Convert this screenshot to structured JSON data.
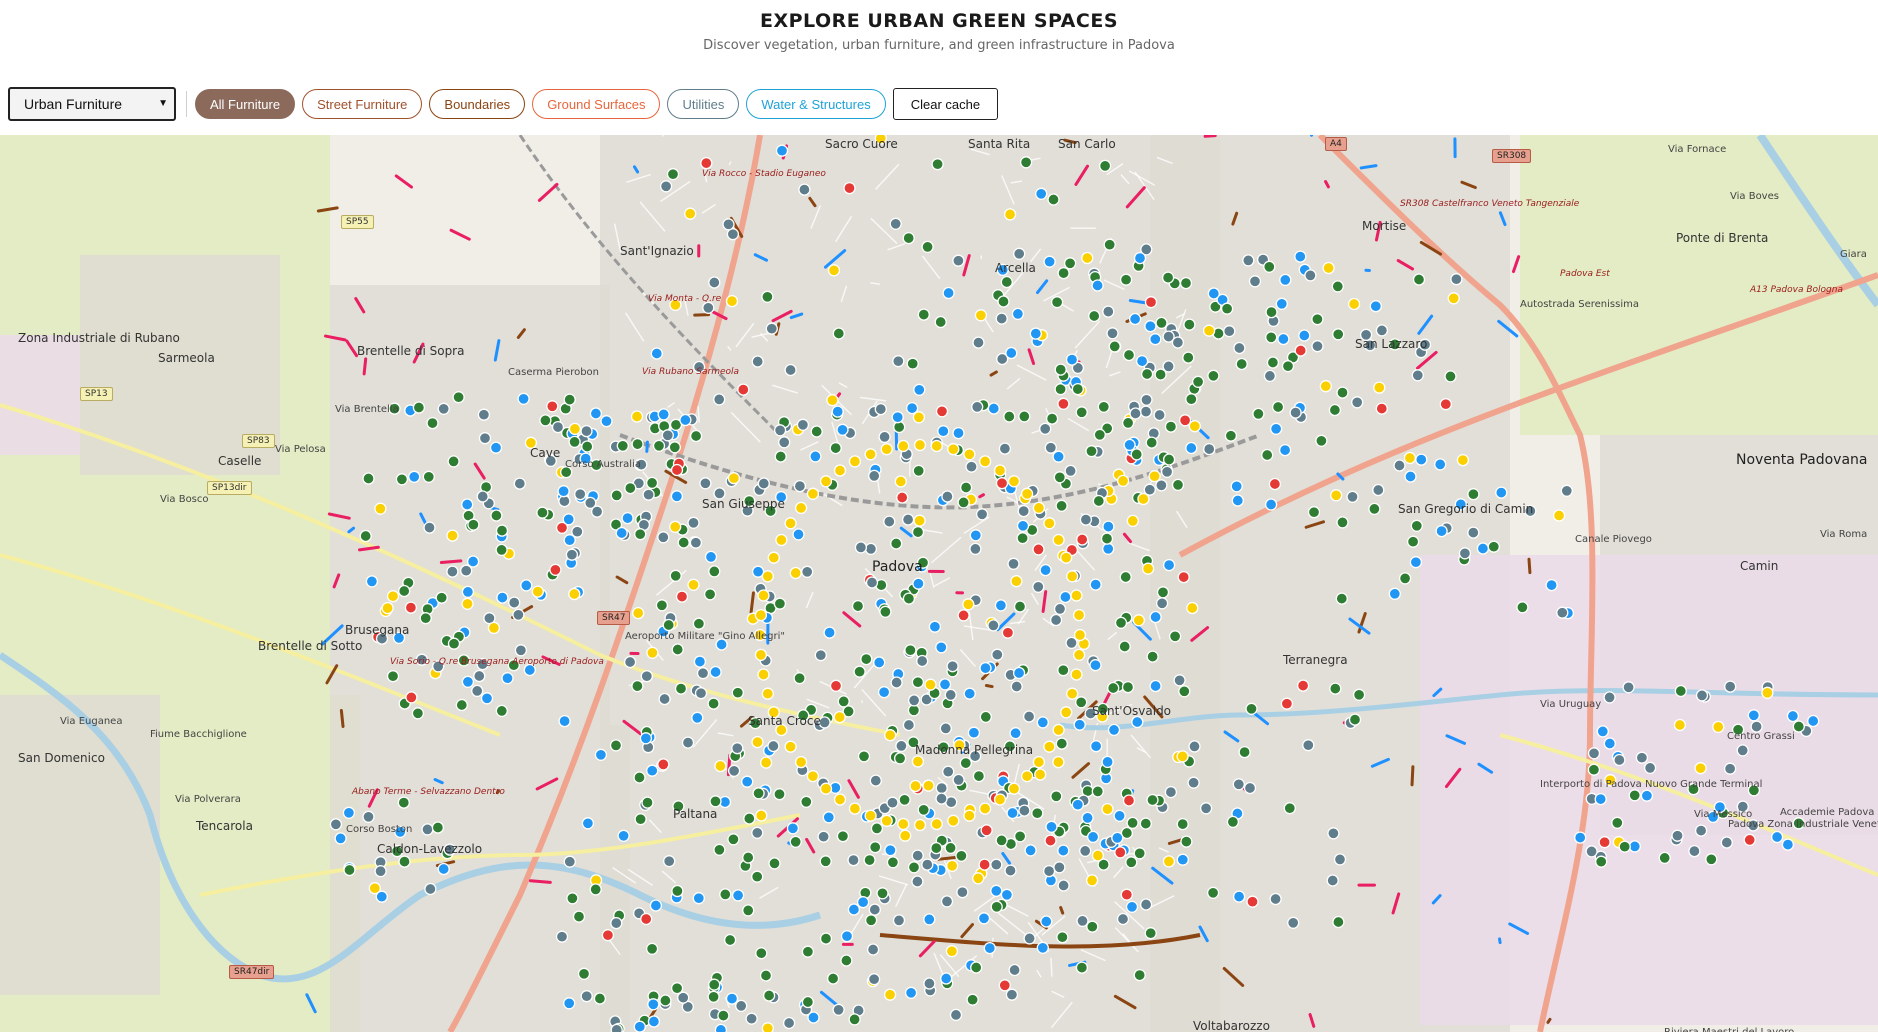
{
  "header": {
    "title": "EXPLORE URBAN GREEN SPACES",
    "subtitle": "Discover vegetation, urban furniture, and green infrastructure in Padova"
  },
  "toolbar": {
    "category_select": {
      "selected": "Urban Furniture"
    },
    "filters": [
      {
        "label": "All Furniture",
        "color": "#8b6a5c",
        "active": true
      },
      {
        "label": "Street Furniture",
        "color": "#a0522d",
        "active": false
      },
      {
        "label": "Boundaries",
        "color": "#8b4513",
        "active": false
      },
      {
        "label": "Ground Surfaces",
        "color": "#e8663d",
        "active": false
      },
      {
        "label": "Utilities",
        "color": "#607d8b",
        "active": false
      },
      {
        "label": "Water & Structures",
        "color": "#1fa3d6",
        "active": false
      }
    ],
    "clear_label": "Clear cache"
  },
  "map": {
    "colors": {
      "background": "#f1eee8",
      "farmland": "#e3ecc4",
      "residential": "#dedcd4",
      "industrial": "#ebdbe8",
      "water": "#a9cfe4",
      "major_road": "#f0a48e",
      "secondary_road": "#f6ef9f",
      "rail": "#9a9a9a",
      "marker_green": "#2e7d32",
      "marker_blue": "#2196f3",
      "marker_gray": "#607d8b",
      "marker_yellow": "#fbd000",
      "marker_red": "#e53935",
      "line_brown": "#8b4513",
      "line_magenta": "#e91e63",
      "line_blue": "#1e90ff"
    },
    "places": [
      {
        "name": "Padova",
        "kind": "city"
      },
      {
        "name": "Noventa Padovana",
        "kind": "city"
      },
      {
        "name": "Sarmeola",
        "kind": "town"
      },
      {
        "name": "Zona Industriale di Rubano",
        "kind": "town"
      },
      {
        "name": "Caselle",
        "kind": "town"
      },
      {
        "name": "Brentelle di Sopra",
        "kind": "town"
      },
      {
        "name": "Sant'Ignazio",
        "kind": "town"
      },
      {
        "name": "Arcella",
        "kind": "town"
      },
      {
        "name": "Sacro Cuore",
        "kind": "town"
      },
      {
        "name": "Santa Rita",
        "kind": "town"
      },
      {
        "name": "San Carlo",
        "kind": "town"
      },
      {
        "name": "Mortise",
        "kind": "town"
      },
      {
        "name": "Ponte di Brenta",
        "kind": "town"
      },
      {
        "name": "San Lazzaro",
        "kind": "town"
      },
      {
        "name": "Cave",
        "kind": "town"
      },
      {
        "name": "San Giuseppe",
        "kind": "town"
      },
      {
        "name": "San Gregorio di Camin",
        "kind": "town"
      },
      {
        "name": "Camin",
        "kind": "town"
      },
      {
        "name": "Brusegana",
        "kind": "town"
      },
      {
        "name": "Brentelle di Sotto",
        "kind": "town"
      },
      {
        "name": "Tencarola",
        "kind": "town"
      },
      {
        "name": "San Domenico",
        "kind": "town"
      },
      {
        "name": "Paltana",
        "kind": "town"
      },
      {
        "name": "Madonna Pellegrina",
        "kind": "town"
      },
      {
        "name": "Santa Croce",
        "kind": "town"
      },
      {
        "name": "Sant'Osvaldo",
        "kind": "town"
      },
      {
        "name": "Terranegra",
        "kind": "town"
      },
      {
        "name": "Voltabarozzo",
        "kind": "town"
      },
      {
        "name": "Caldon-Lavezzolo",
        "kind": "town"
      },
      {
        "name": "Centro Grassi",
        "kind": "small"
      },
      {
        "name": "Interporto di Padova Nuovo Grande Terminal",
        "kind": "small"
      },
      {
        "name": "Accademie Padova Zona Industriale",
        "kind": "small"
      },
      {
        "name": "Padova Zona Industriale Venete",
        "kind": "small"
      },
      {
        "name": "Aeroporto Militare \"Gino Allegri\"",
        "kind": "small"
      },
      {
        "name": "Caserma Pierobon",
        "kind": "small"
      },
      {
        "name": "Via Rocco - Stadio Euganeo",
        "kind": "italic"
      },
      {
        "name": "Via Monta - Q.re",
        "kind": "italic"
      },
      {
        "name": "Via Rubano Sarmeola",
        "kind": "italic"
      },
      {
        "name": "Via Sorio - Q.re Brusegana Aeroporto di Padova",
        "kind": "italic"
      },
      {
        "name": "Abano Terme - Selvazzano Dentro",
        "kind": "italic"
      },
      {
        "name": "SR308 Castelfranco Veneto Tangenziale",
        "kind": "italic"
      },
      {
        "name": "Padova Est",
        "kind": "italic"
      },
      {
        "name": "A13 Padova Bologna",
        "kind": "italic"
      },
      {
        "name": "Via Pelosa",
        "kind": "small"
      },
      {
        "name": "Via Brentella",
        "kind": "small"
      },
      {
        "name": "Via Euganea",
        "kind": "small"
      },
      {
        "name": "Via Bosco",
        "kind": "small"
      },
      {
        "name": "Via Polverara",
        "kind": "small"
      },
      {
        "name": "Via Boves",
        "kind": "small"
      },
      {
        "name": "Via Roma",
        "kind": "small"
      },
      {
        "name": "Autostrada Serenissima",
        "kind": "small"
      },
      {
        "name": "Canale Piovego",
        "kind": "small"
      },
      {
        "name": "Fiume Bacchiglione",
        "kind": "small"
      },
      {
        "name": "Corso Australia",
        "kind": "small"
      },
      {
        "name": "Corso Boston",
        "kind": "small"
      },
      {
        "name": "Via Uruguay",
        "kind": "small"
      },
      {
        "name": "Via Messico",
        "kind": "small"
      },
      {
        "name": "Riviera Maestri del Lavoro",
        "kind": "small"
      },
      {
        "name": "Via Fornace",
        "kind": "small"
      },
      {
        "name": "Giara",
        "kind": "small"
      }
    ],
    "shields": [
      {
        "label": "A4",
        "kind": "red"
      },
      {
        "label": "SR308",
        "kind": "red"
      },
      {
        "label": "SP55",
        "kind": "yel"
      },
      {
        "label": "SP13",
        "kind": "yel"
      },
      {
        "label": "SP83",
        "kind": "yel"
      },
      {
        "label": "SP13dir",
        "kind": "yel"
      },
      {
        "label": "SR47",
        "kind": "red"
      },
      {
        "label": "SR47dir",
        "kind": "red"
      }
    ]
  }
}
